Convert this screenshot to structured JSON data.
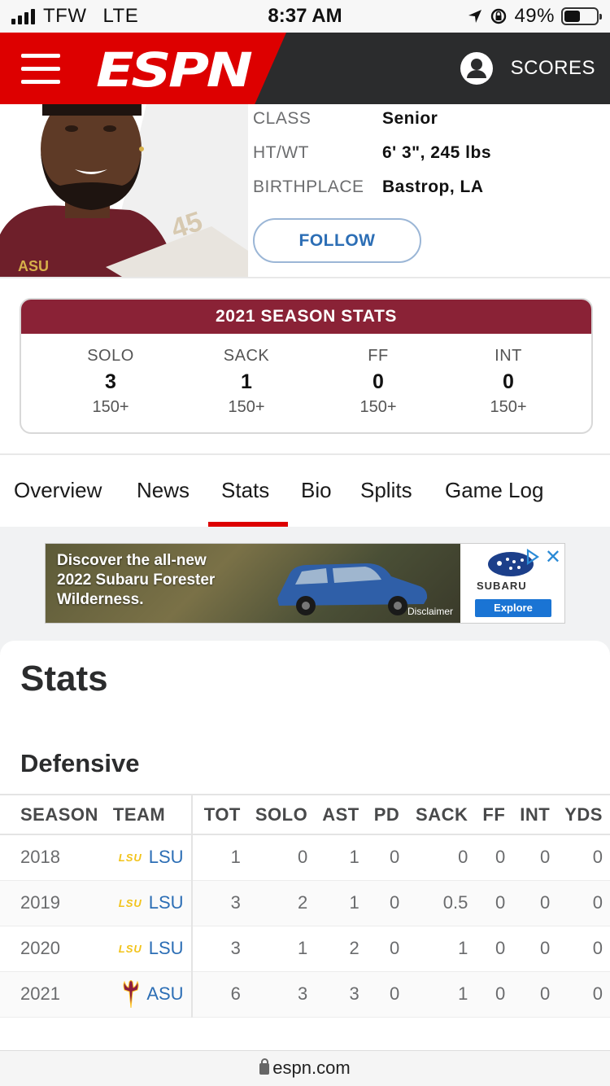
{
  "status_bar": {
    "carrier": "TFW",
    "network": "LTE",
    "time": "8:37 AM",
    "battery": "49%",
    "battery_level": 0.49
  },
  "header": {
    "logo": "ESPN",
    "scores_label": "SCORES",
    "brand_red": "#dd0000",
    "bar_dark": "#2b2c2d"
  },
  "player": {
    "class_label": "CLASS",
    "class_value": "Senior",
    "htwt_label": "HT/WT",
    "htwt_value": "6' 3\", 245 lbs",
    "birthplace_label": "BIRTHPLACE",
    "birthplace_value": "Bastrop, LA",
    "follow_label": "FOLLOW"
  },
  "season_stats": {
    "title": "2021 SEASON STATS",
    "accent": "#8a2236",
    "items": [
      {
        "label": "SOLO",
        "value": "3",
        "rank": "150+"
      },
      {
        "label": "SACK",
        "value": "1",
        "rank": "150+"
      },
      {
        "label": "FF",
        "value": "0",
        "rank": "150+"
      },
      {
        "label": "INT",
        "value": "0",
        "rank": "150+"
      }
    ]
  },
  "tabs": [
    {
      "label": "Overview"
    },
    {
      "label": "News"
    },
    {
      "label": "Stats",
      "active": true
    },
    {
      "label": "Bio"
    },
    {
      "label": "Splits"
    },
    {
      "label": "Game Log"
    }
  ],
  "ad": {
    "headline_1": "Discover the all-new",
    "headline_2": "2022 Subaru Forester",
    "headline_3": "Wilderness.",
    "disclaimer": "Disclaimer",
    "brand": "SUBARU",
    "cta": "Explore"
  },
  "stats": {
    "title": "Stats",
    "section": "Defensive",
    "columns": [
      "SEASON",
      "TEAM",
      "TOT",
      "SOLO",
      "AST",
      "PD",
      "SACK",
      "FF",
      "INT",
      "YDS"
    ],
    "rows": [
      {
        "season": "2018",
        "logo": "LSU",
        "team": "LSU",
        "tot": "1",
        "solo": "0",
        "ast": "1",
        "pd": "0",
        "sack": "0",
        "ff": "0",
        "int": "0",
        "yds": "0"
      },
      {
        "season": "2019",
        "logo": "LSU",
        "team": "LSU",
        "tot": "3",
        "solo": "2",
        "ast": "1",
        "pd": "0",
        "sack": "0.5",
        "ff": "0",
        "int": "0",
        "yds": "0"
      },
      {
        "season": "2020",
        "logo": "LSU",
        "team": "LSU",
        "tot": "3",
        "solo": "1",
        "ast": "2",
        "pd": "0",
        "sack": "1",
        "ff": "0",
        "int": "0",
        "yds": "0"
      },
      {
        "season": "2021",
        "logo": "",
        "team": "ASU",
        "tot": "6",
        "solo": "3",
        "ast": "3",
        "pd": "0",
        "sack": "1",
        "ff": "0",
        "int": "0",
        "yds": "0"
      }
    ]
  },
  "url_bar": {
    "url": "espn.com"
  }
}
